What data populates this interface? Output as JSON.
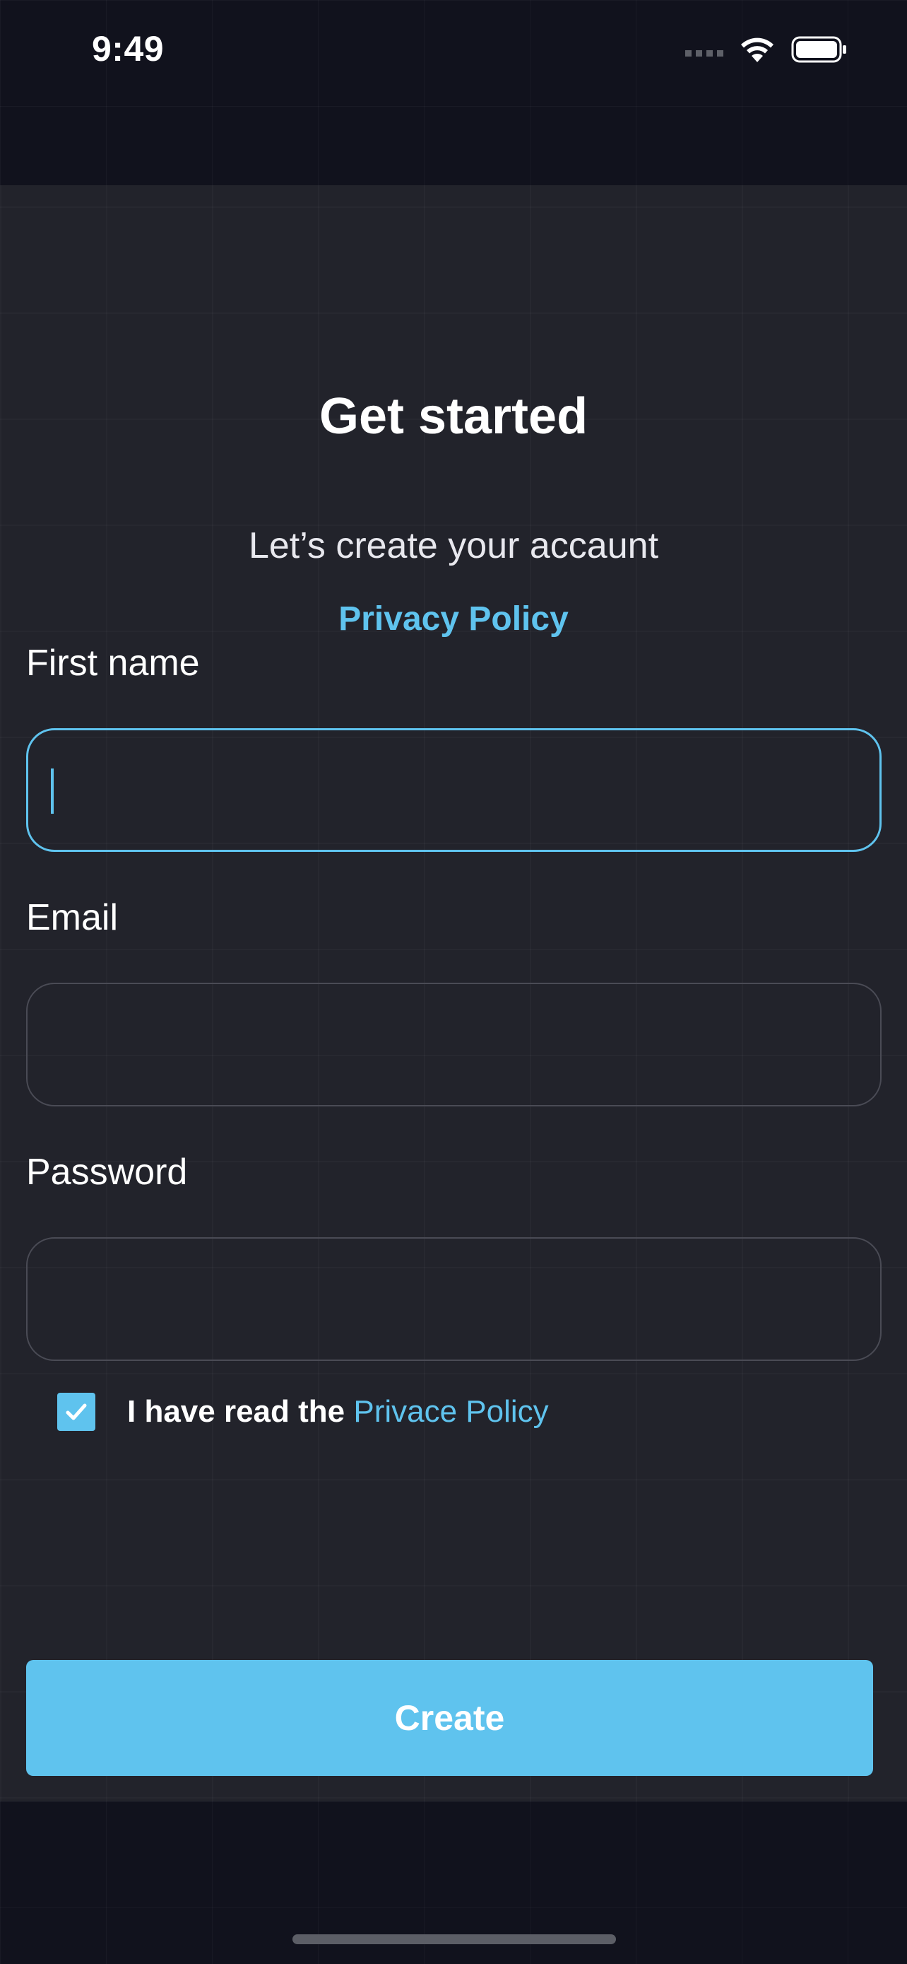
{
  "status_bar": {
    "time": "9:49",
    "icons": [
      "signal-dots-icon",
      "wifi-icon",
      "battery-icon"
    ]
  },
  "header": {
    "title": "Get started",
    "subtitle": "Let’s create your accaunt",
    "privacy_link": "Privacy Policy"
  },
  "form": {
    "first_name": {
      "label": "First name",
      "value": "",
      "placeholder": ""
    },
    "email": {
      "label": "Email",
      "value": "",
      "placeholder": ""
    },
    "password": {
      "label": "Password",
      "value": "",
      "placeholder": ""
    }
  },
  "consent": {
    "checked": true,
    "text": "I have read the ",
    "link": "Privace Policy"
  },
  "actions": {
    "create_label": "Create"
  },
  "colors": {
    "accent": "#5fc3ee",
    "background": "#11121d",
    "panel": "#22232b",
    "field_border": "#4a4b55"
  }
}
